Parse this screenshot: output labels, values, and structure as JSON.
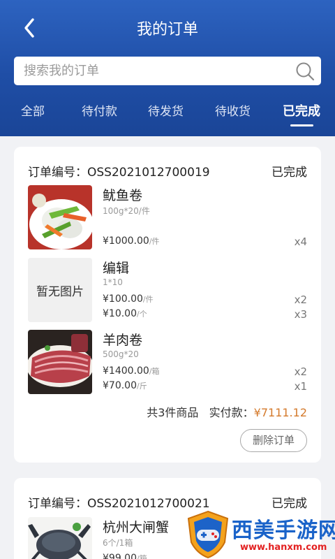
{
  "header": {
    "title": "我的订单",
    "back_icon": "chevron-left-icon",
    "gradient": [
      "#2d63c0",
      "#1a4597"
    ]
  },
  "search": {
    "placeholder": "搜索我的订单",
    "value": "",
    "icon": "search-icon"
  },
  "tabs": [
    {
      "label": "全部",
      "active": false
    },
    {
      "label": "待付款",
      "active": false
    },
    {
      "label": "待发货",
      "active": false
    },
    {
      "label": "待收货",
      "active": false
    },
    {
      "label": "已完成",
      "active": true
    }
  ],
  "orders": [
    {
      "order_no": "订单编号：OSS2021012700019",
      "status": "已完成",
      "items": [
        {
          "name": "鱿鱼卷",
          "spec": "100g*20/件",
          "image": "squid-roll",
          "prices": [
            {
              "price": "¥1000.00",
              "unit": "/件",
              "qty": "x4"
            }
          ]
        },
        {
          "name": "编辑",
          "spec": "1*10",
          "image": "none",
          "no_image_text": "暂无图片",
          "prices": [
            {
              "price": "¥100.00",
              "unit": "/件",
              "qty": "x2"
            },
            {
              "price": "¥10.00",
              "unit": "/个",
              "qty": "x3"
            }
          ]
        },
        {
          "name": "羊肉卷",
          "spec": "500g*20",
          "image": "mutton-roll",
          "prices": [
            {
              "price": "¥1400.00",
              "unit": "/箱",
              "qty": "x2"
            },
            {
              "price": "¥70.00",
              "unit": "/斤",
              "qty": "x1"
            }
          ]
        }
      ],
      "total_count": "共3件商品",
      "paid_label": "实付款：",
      "paid_amount": "¥7111.12",
      "delete_label": "删除订单"
    },
    {
      "order_no": "订单编号：OSS2021012700021",
      "status": "已完成",
      "items": [
        {
          "name": "杭州大闸蟹",
          "spec": "6个/1箱",
          "image": "crab",
          "prices": [
            {
              "price": "¥99.00",
              "unit": "/箱",
              "qty": ""
            }
          ]
        }
      ]
    }
  ],
  "watermark": {
    "text": "西美手游网",
    "url": "www.hanxm.com",
    "icon": "gamepad-shield-icon"
  },
  "colors": {
    "accent": "#1f4ea6",
    "paid_amount": "#d47a2c",
    "watermark_blue": "#1a63c9",
    "watermark_red": "#e32222"
  }
}
